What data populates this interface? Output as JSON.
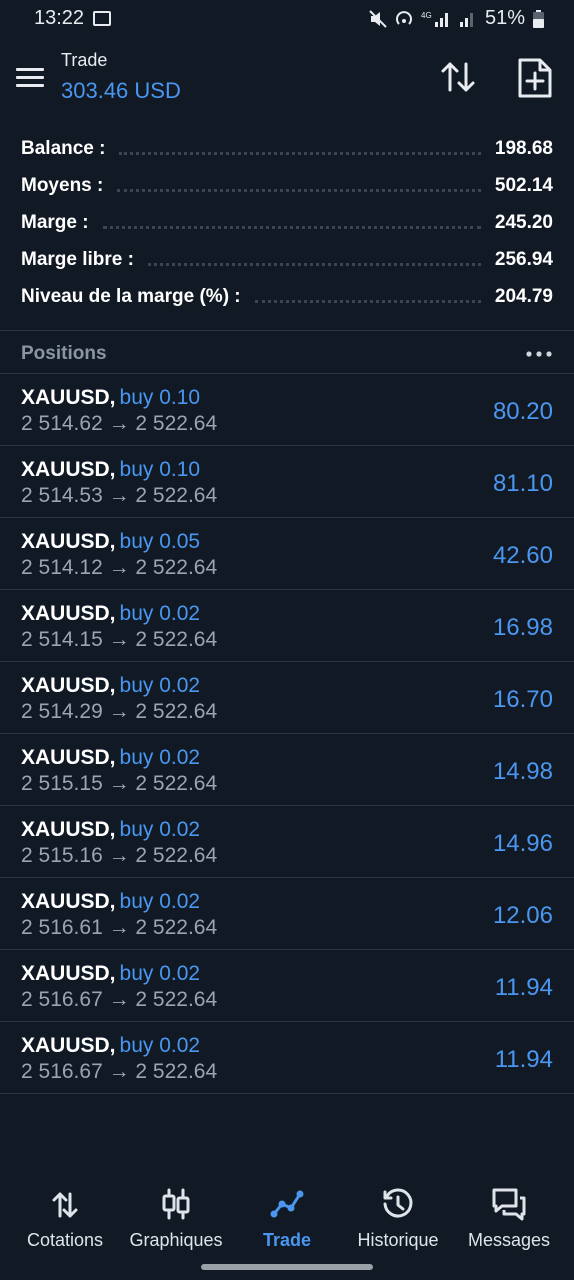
{
  "status": {
    "time": "13:22",
    "battery": "51%"
  },
  "header": {
    "title": "Trade",
    "balance_line": "303.46 USD"
  },
  "summary": [
    {
      "label": "Balance :",
      "value": "198.68"
    },
    {
      "label": "Moyens :",
      "value": "502.14"
    },
    {
      "label": "Marge :",
      "value": "245.20"
    },
    {
      "label": "Marge libre :",
      "value": "256.94"
    },
    {
      "label": "Niveau de la marge (%) :",
      "value": "204.79"
    }
  ],
  "positions_title": "Positions",
  "positions": [
    {
      "symbol": "XAUUSD,",
      "side": "buy 0.10",
      "prices": "2 514.62 → 2 522.64",
      "profit": "80.20"
    },
    {
      "symbol": "XAUUSD,",
      "side": "buy 0.10",
      "prices": "2 514.53 → 2 522.64",
      "profit": "81.10"
    },
    {
      "symbol": "XAUUSD,",
      "side": "buy 0.05",
      "prices": "2 514.12 → 2 522.64",
      "profit": "42.60"
    },
    {
      "symbol": "XAUUSD,",
      "side": "buy 0.02",
      "prices": "2 514.15 → 2 522.64",
      "profit": "16.98"
    },
    {
      "symbol": "XAUUSD,",
      "side": "buy 0.02",
      "prices": "2 514.29 → 2 522.64",
      "profit": "16.70"
    },
    {
      "symbol": "XAUUSD,",
      "side": "buy 0.02",
      "prices": "2 515.15 → 2 522.64",
      "profit": "14.98"
    },
    {
      "symbol": "XAUUSD,",
      "side": "buy 0.02",
      "prices": "2 515.16 → 2 522.64",
      "profit": "14.96"
    },
    {
      "symbol": "XAUUSD,",
      "side": "buy 0.02",
      "prices": "2 516.61 → 2 522.64",
      "profit": "12.06"
    },
    {
      "symbol": "XAUUSD,",
      "side": "buy 0.02",
      "prices": "2 516.67 → 2 522.64",
      "profit": "11.94"
    },
    {
      "symbol": "XAUUSD,",
      "side": "buy 0.02",
      "prices": "2 516.67 → 2 522.64",
      "profit": "11.94"
    }
  ],
  "nav": [
    {
      "label": "Cotations",
      "icon": "quotes-icon",
      "active": false
    },
    {
      "label": "Graphiques",
      "icon": "charts-icon",
      "active": false
    },
    {
      "label": "Trade",
      "icon": "trade-icon",
      "active": true
    },
    {
      "label": "Historique",
      "icon": "history-icon",
      "active": false
    },
    {
      "label": "Messages",
      "icon": "messages-icon",
      "active": false
    }
  ],
  "colors": {
    "background": "#111a24",
    "accent": "#4a96f0",
    "muted": "#9aa5b1"
  }
}
